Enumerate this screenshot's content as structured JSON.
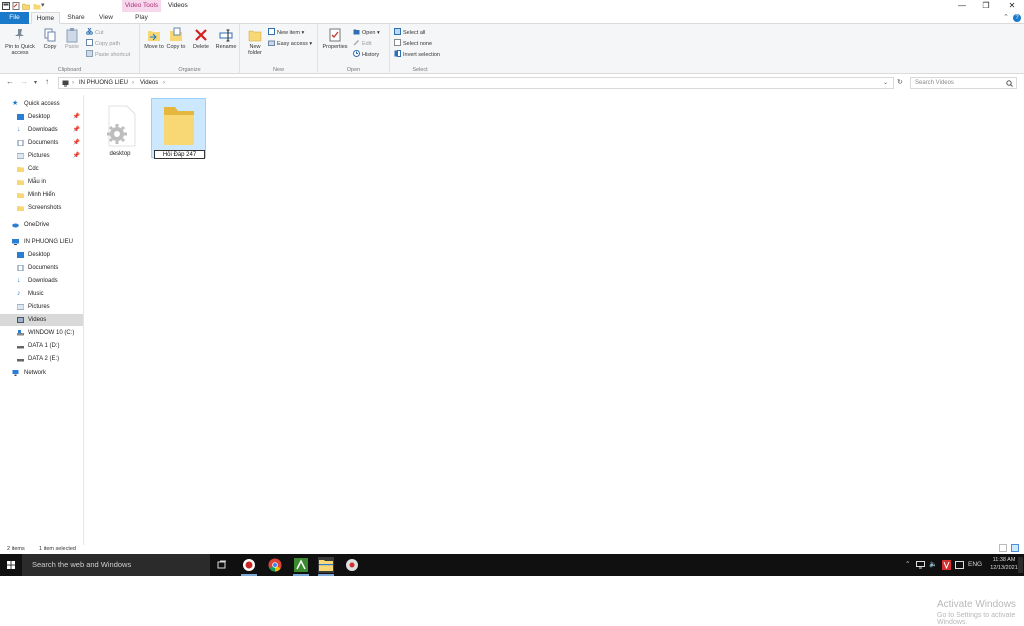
{
  "window": {
    "title": "Videos",
    "context_tab": "Video Tools",
    "controls": {
      "minimize": "—",
      "maximize": "❐",
      "close": "✕",
      "collapse": "⌃",
      "help": "?"
    }
  },
  "tabs": {
    "file": "File",
    "home": "Home",
    "share": "Share",
    "view": "View",
    "play": "Play"
  },
  "ribbon": {
    "clipboard": {
      "label": "Clipboard",
      "pin_to_quick_access": "Pin to Quick access",
      "copy": "Copy",
      "paste": "Paste",
      "cut": "Cut",
      "copy_path": "Copy path",
      "paste_shortcut": "Paste shortcut"
    },
    "organize": {
      "label": "Organize",
      "move_to": "Move to",
      "copy_to": "Copy to",
      "delete": "Delete",
      "rename": "Rename"
    },
    "new": {
      "label": "New",
      "new_folder": "New folder",
      "new_item": "New item",
      "easy_access": "Easy access"
    },
    "open": {
      "label": "Open",
      "properties": "Properties",
      "open": "Open",
      "edit": "Edit",
      "history": "History"
    },
    "select": {
      "label": "Select",
      "select_all": "Select all",
      "select_none": "Select none",
      "invert_selection": "Invert selection"
    }
  },
  "address": {
    "crumbs": [
      "IN PHUONG LIEU",
      "Videos"
    ],
    "separator": "›",
    "search_placeholder": "Search Videos"
  },
  "nav": {
    "quick_access": "Quick access",
    "quick_items": [
      "Desktop",
      "Downloads",
      "Documents",
      "Pictures",
      "Cdc",
      "Mẫu in",
      "Minh Hiển",
      "Screenshots"
    ],
    "onedrive": "OneDrive",
    "this_pc": "IN PHUONG LIEU",
    "pc_items": [
      "Desktop",
      "Documents",
      "Downloads",
      "Music",
      "Pictures",
      "Videos",
      "WINDOW 10 (C:)",
      "DATA 1 (D:)",
      "DATA 2 (E:)"
    ],
    "network": "Network"
  },
  "content": {
    "items": [
      {
        "name": "desktop",
        "type": "settings-file"
      },
      {
        "name": "Hỏi Đáp 247",
        "type": "folder",
        "renaming": true
      }
    ]
  },
  "watermark": {
    "title": "Activate Windows",
    "subtitle": "Go to Settings to activate Windows."
  },
  "status": {
    "count": "2 items",
    "selected": "1 item selected"
  },
  "taskbar": {
    "search_placeholder": "Search the web and Windows",
    "language": "ENG",
    "time": "11:38 AM",
    "date": "12/13/2021"
  },
  "colors": {
    "accent": "#1979ca",
    "selection": "#cce8ff",
    "context_tab": "#f6d7ec",
    "folder": "#f8d775"
  }
}
